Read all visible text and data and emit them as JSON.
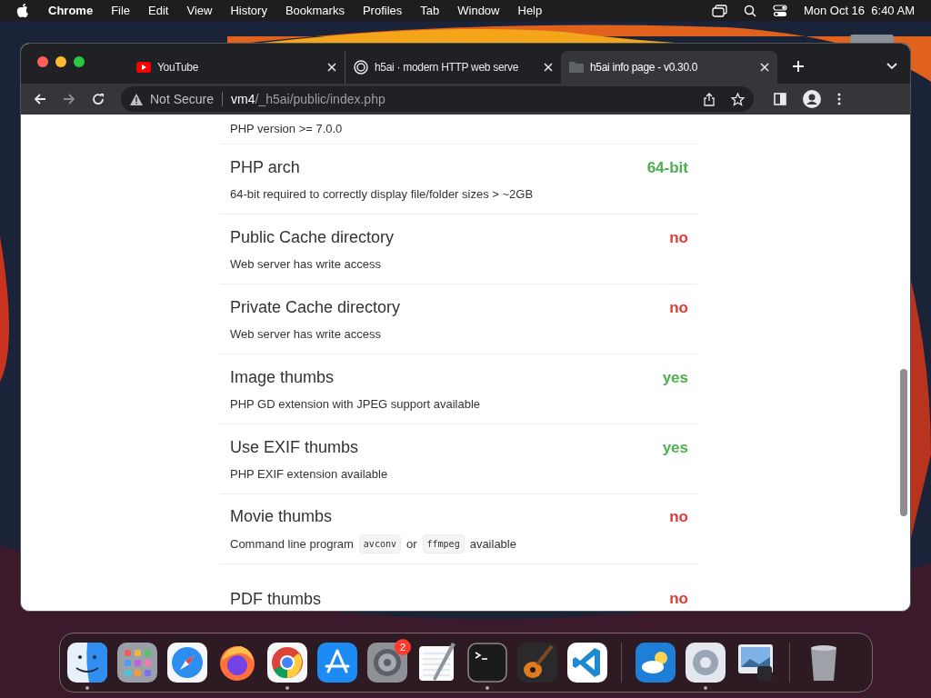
{
  "menu_bar": {
    "app": "Chrome",
    "items": [
      "File",
      "Edit",
      "View",
      "History",
      "Bookmarks",
      "Profiles",
      "Tab",
      "Window",
      "Help"
    ],
    "clock": "Mon Oct 16  6:40 AM"
  },
  "browser": {
    "tabs": [
      {
        "title": "YouTube",
        "kind": "youtube",
        "selected": false
      },
      {
        "title": "h5ai · modern HTTP web serve",
        "kind": "globe",
        "selected": false
      },
      {
        "title": "h5ai info page - v0.30.0",
        "kind": "folder",
        "selected": true
      }
    ],
    "security": "Not Secure",
    "url_host": "vm4",
    "url_path": "/_h5ai/public/index.php"
  },
  "checks": [
    {
      "description": "PHP version >= 7.0.0"
    },
    {
      "title": "PHP arch",
      "description": "64-bit required to correctly display file/folder sizes > ~2GB",
      "status": "64-bit",
      "ok": true
    },
    {
      "title": "Public Cache directory",
      "description": "Web server has write access",
      "status": "no",
      "ok": false
    },
    {
      "title": "Private Cache directory",
      "description": "Web server has write access",
      "status": "no",
      "ok": false
    },
    {
      "title": "Image thumbs",
      "description": "PHP GD extension with JPEG support available",
      "status": "yes",
      "ok": true
    },
    {
      "title": "Use EXIF thumbs",
      "description": "PHP EXIF extension available",
      "status": "yes",
      "ok": true
    },
    {
      "title": "Movie thumbs",
      "description_parts": [
        {
          "kind": "text",
          "text": "Command line program"
        },
        {
          "kind": "code",
          "text": "avconv"
        },
        {
          "kind": "text",
          "text": "or"
        },
        {
          "kind": "code",
          "text": "ffmpeg"
        },
        {
          "kind": "text",
          "text": "available"
        }
      ],
      "status": "no",
      "ok": false
    },
    {
      "title": "PDF thumbs",
      "status": "no",
      "ok": false
    }
  ],
  "dock": [
    {
      "kind": "finder",
      "running": true
    },
    {
      "kind": "launchpad",
      "running": false
    },
    {
      "kind": "safari",
      "running": false
    },
    {
      "kind": "firefox",
      "running": false
    },
    {
      "kind": "chrome",
      "running": true
    },
    {
      "kind": "appstore",
      "running": false
    },
    {
      "kind": "settings",
      "running": false,
      "badge": "2"
    },
    {
      "kind": "textedit",
      "running": false
    },
    {
      "kind": "terminal",
      "running": true
    },
    {
      "kind": "garageband",
      "running": false
    },
    {
      "kind": "vscode",
      "running": false
    },
    {
      "kind": "divider"
    },
    {
      "kind": "weather",
      "running": false
    },
    {
      "kind": "gear",
      "running": true
    },
    {
      "kind": "preview",
      "running": false
    },
    {
      "kind": "divider"
    },
    {
      "kind": "trash",
      "running": false
    }
  ]
}
